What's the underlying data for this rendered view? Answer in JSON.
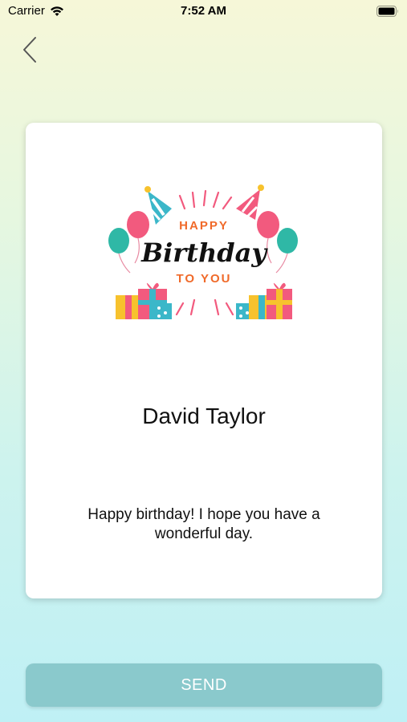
{
  "status_bar": {
    "carrier": "Carrier",
    "time": "7:52 AM"
  },
  "nav": {
    "back_icon": "chevron-left-icon"
  },
  "card": {
    "image": {
      "line1": "HAPPY",
      "line2": "Birthday",
      "line3": "TO YOU"
    },
    "recipient_name": "David Taylor",
    "message": "Happy birthday! I hope you have a wonderful day."
  },
  "actions": {
    "send_label": "SEND"
  },
  "colors": {
    "send_button": "#8ac9cc",
    "card_background": "#ffffff",
    "accent_orange": "#f06a2a",
    "accent_pink": "#f25a7e",
    "accent_teal": "#2fb8a6"
  }
}
